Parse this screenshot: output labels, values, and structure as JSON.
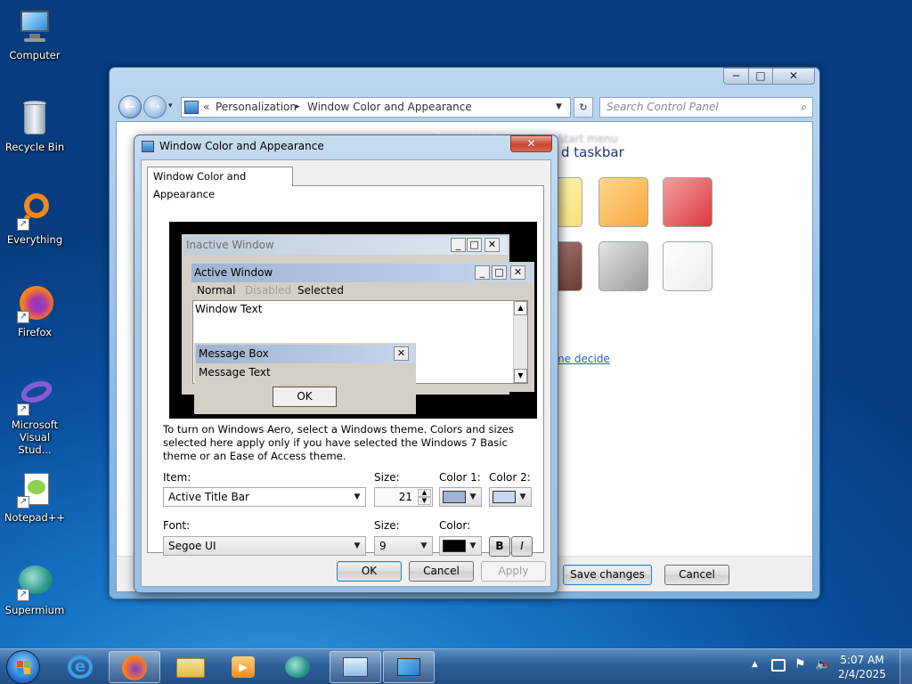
{
  "desktop": {
    "icons": [
      {
        "label": "Computer",
        "icon": "computer-icon"
      },
      {
        "label": "Recycle Bin",
        "icon": "recycle-bin-icon"
      },
      {
        "label": "Everything",
        "icon": "everything-icon"
      },
      {
        "label": "Firefox",
        "icon": "firefox-icon"
      },
      {
        "label": "Microsoft Visual Stud...",
        "icon": "visual-studio-icon"
      },
      {
        "label": "Notepad++",
        "icon": "notepadpp-icon"
      },
      {
        "label": "Supermium",
        "icon": "supermium-icon"
      }
    ]
  },
  "parent_window": {
    "breadcrumb": [
      "Personalization",
      "Window Color and Appearance"
    ],
    "search_placeholder": "Search Control Panel",
    "partial_heading": "d taskbar",
    "partial_link": "me decide",
    "blurred_text": "of your window borders, Start menu",
    "save_label": "Save changes",
    "cancel_label": "Cancel",
    "swatch_colors": [
      "#f7e27a",
      "#f7a640",
      "#d9383c",
      "#7a4a3a",
      "#a9a9a9",
      "#f4f4f4"
    ]
  },
  "dialog": {
    "title": "Window Color and Appearance",
    "tab_label": "Window Color and Appearance",
    "preview": {
      "inactive_title": "Inactive Window",
      "active_title": "Active Window",
      "menu_normal": "Normal",
      "menu_disabled": "Disabled",
      "menu_selected": "Selected",
      "window_text": "Window Text",
      "msgbox_title": "Message Box",
      "msgbox_text": "Message Text",
      "msgbox_ok": "OK"
    },
    "info_text": "To turn on Windows Aero, select a Windows theme.  Colors and sizes selected here apply only if you have selected the Windows 7 Basic theme or an Ease of Access theme.",
    "item_label": "Item:",
    "item_value": "Active Title Bar",
    "size_label": "Size:",
    "size_value": "21",
    "color1_label": "Color 1:",
    "color2_label": "Color 2:",
    "color1": "#9fb4d2",
    "color2": "#c6d7ee",
    "font_label": "Font:",
    "font_value": "Segoe UI",
    "font_size_label": "Size:",
    "font_size_value": "9",
    "font_color_label": "Color:",
    "font_color": "#000000",
    "bold_label": "B",
    "italic_label": "I",
    "ok_label": "OK",
    "cancel_label": "Cancel",
    "apply_label": "Apply"
  },
  "taskbar": {
    "time": "5:07 AM",
    "date": "2/4/2025"
  }
}
